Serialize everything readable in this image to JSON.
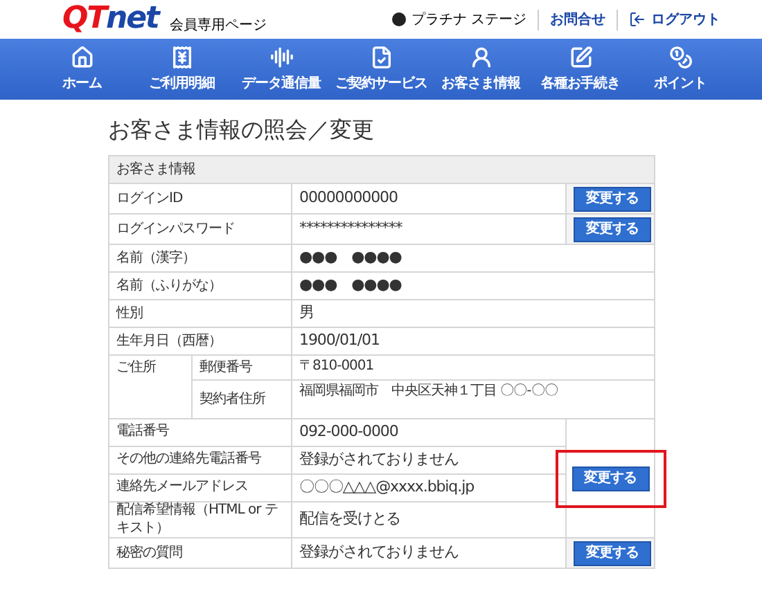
{
  "header": {
    "logo": [
      {
        "text": "QT",
        "color": "#e8141c"
      },
      {
        "text": "net",
        "color": "#1b47a7"
      }
    ],
    "subtitle": "会員専用ページ",
    "stage": "プラチナ ステージ",
    "links": [
      {
        "label": "お問合せ",
        "kind": "text"
      },
      {
        "label": "ログアウト",
        "kind": "logout"
      }
    ]
  },
  "nav": [
    {
      "label": "ホーム",
      "kind": "home"
    },
    {
      "label": "ご利用明細",
      "kind": "bill"
    },
    {
      "label": "データ通信量",
      "kind": "wave"
    },
    {
      "label": "ご契約サービス",
      "kind": "contract"
    },
    {
      "label": "お客さま情報",
      "kind": "user"
    },
    {
      "label": "各種お手続き",
      "kind": "edit"
    },
    {
      "label": "ポイント",
      "kind": "point"
    }
  ],
  "page_title": "お客さま情報の照会／変更",
  "table": {
    "caption": "お客さま情報",
    "rows": [
      {
        "kind": "field",
        "label": "ログインID",
        "value": "00000000000",
        "button": {
          "label": "変更する",
          "highlighted": false
        }
      },
      {
        "kind": "field",
        "label": "ログインパスワード",
        "value": "***************",
        "button": {
          "label": "変更する",
          "highlighted": false
        }
      },
      {
        "kind": "field",
        "label": "名前（漢字）",
        "value": "●●●　●●●●"
      },
      {
        "kind": "field",
        "label": "名前（ふりがな）",
        "value": "●●●　●●●●"
      },
      {
        "kind": "field",
        "label": "性別",
        "value": "男"
      },
      {
        "kind": "field",
        "label": "生年月日（西暦）",
        "value": "1900/01/01"
      },
      {
        "kind": "address",
        "label": "ご住所",
        "parts": [
          {
            "label": "郵便番号",
            "value": "〒810-0001"
          },
          {
            "label": "契約者住所",
            "value": "福岡県福岡市　中央区天神１丁目 〇〇-〇〇"
          }
        ]
      },
      {
        "kind": "group",
        "rows": [
          {
            "label": "電話番号",
            "value": "092-000-0000"
          },
          {
            "label": "その他の連絡先電話番号",
            "value": "登録がされておりません"
          },
          {
            "label": "連絡先メールアドレス",
            "value": "〇〇〇△△△@xxxx.bbiq.jp"
          },
          {
            "label": "配信希望情報（HTML or テキスト）",
            "value": "配信を受けとる"
          }
        ],
        "button": {
          "label": "変更する",
          "highlighted": true
        }
      },
      {
        "kind": "field",
        "label": "秘密の質問",
        "value": "登録がされておりません",
        "button": {
          "label": "変更する",
          "highlighted": false
        }
      }
    ]
  }
}
